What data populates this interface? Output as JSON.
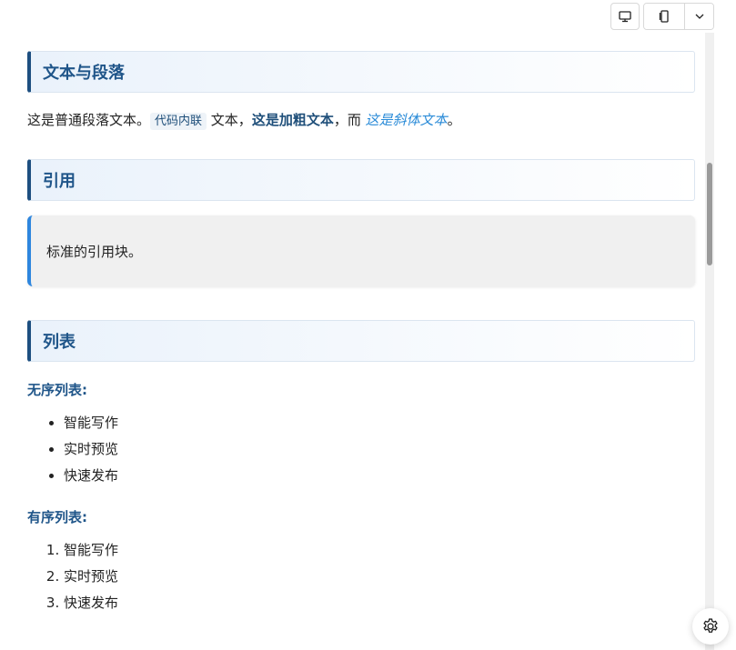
{
  "toolbar": {
    "icons": [
      "monitor-icon",
      "mobile-icon",
      "chevron-down-icon"
    ]
  },
  "sections": {
    "text": {
      "title": "文本与段落",
      "para_prefix": "这是普通段落文本。",
      "inline_code": "代码内联",
      "para_mid": " 文本，",
      "bold": "这是加粗文本",
      "para_conj": "，而 ",
      "italic": "这是斜体文本",
      "para_end": "。"
    },
    "quote": {
      "title": "引用",
      "text": "标准的引用块。"
    },
    "lists": {
      "title": "列表",
      "unordered_caption": "无序列表:",
      "unordered_items": [
        "智能写作",
        "实时预览",
        "快速发布"
      ],
      "ordered_caption": "有序列表:",
      "ordered_items": [
        "智能写作",
        "实时预览",
        "快速发布"
      ]
    }
  },
  "settings": {
    "icon": "gear-icon"
  },
  "colors": {
    "heading": "#1f5589",
    "accent_border": "#1d4f80",
    "quote_border": "#2e86de",
    "italic": "#2a8bd8"
  }
}
